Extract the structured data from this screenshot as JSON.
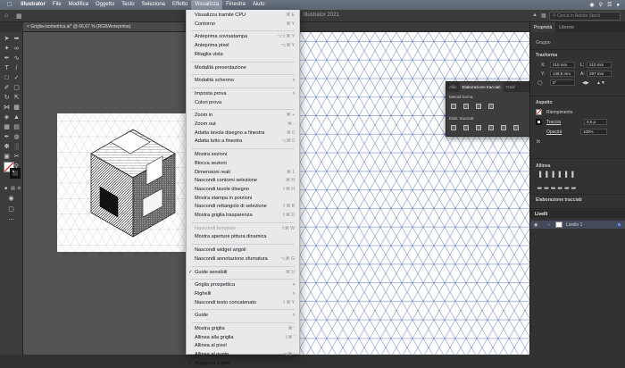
{
  "menubar": {
    "app": "Illustrator",
    "items": [
      "File",
      "Modifica",
      "Oggetto",
      "Testo",
      "Seleziona",
      "Effetto",
      "Visualizza",
      "Finestra",
      "Aiuto"
    ],
    "active": "Visualizza"
  },
  "appbar": {
    "title": "Illustrator 2021",
    "search_placeholder": "Cerca in Adobe Stock"
  },
  "document": {
    "tab_title": "Griglia-isometrica.ai* @ 66,67 % (RGB/Anteprima)"
  },
  "floating_panel": {
    "tabs": [
      "Allin",
      "Elaborazione tracciati",
      "Trasf"
    ],
    "active_tab": "Elaborazione tracciati",
    "shape_modes_label": "Metodi forma:",
    "pathfinders_label": "Elab. tracciati:"
  },
  "properties_panel": {
    "tabs": [
      "Proprietà",
      "Librerie"
    ],
    "selection_label": "Gruppo",
    "transform_title": "Trasforma",
    "x_label": "X:",
    "x_value": "210 mm",
    "y_label": "Y:",
    "y_value": "148,5 mm",
    "w_label": "L:",
    "w_value": "210 mm",
    "h_label": "A:",
    "h_value": "297 mm",
    "rotation_value": "0°",
    "appearance_title": "Aspetto",
    "fill_label": "Riempimento",
    "stroke_label": "Traccia",
    "stroke_value": "0,5 p",
    "opacity_label": "Opacità",
    "opacity_value": "100%",
    "fx_label": "fx",
    "align_title": "Allinea",
    "pathfinder_title": "Elaborazione tracciati",
    "layers_title": "Livelli",
    "layer_name": "Livello 1"
  },
  "view_menu": {
    "items": [
      {
        "label": "Visualizza tramite CPU",
        "shortcut": "⌘ E"
      },
      {
        "label": "Contorno",
        "shortcut": "⌘ Y"
      },
      {
        "sep": true
      },
      {
        "label": "Anteprima sovrastampa",
        "shortcut": "⌥⇧⌘ Y"
      },
      {
        "label": "Anteprima pixel",
        "shortcut": "⌥⌘ Y"
      },
      {
        "label": "Ritaglia vista"
      },
      {
        "sep": true
      },
      {
        "label": "Modalità presentazione"
      },
      {
        "sep": true
      },
      {
        "label": "Modalità schermo",
        "submenu": true
      },
      {
        "sep": true
      },
      {
        "label": "Imposta prova",
        "submenu": true
      },
      {
        "label": "Colori prova"
      },
      {
        "sep": true
      },
      {
        "label": "Zoom in",
        "shortcut": "⌘ +"
      },
      {
        "label": "Zoom out",
        "shortcut": "⌘ -"
      },
      {
        "label": "Adatta tavola disegno a finestra",
        "shortcut": "⌘ 0"
      },
      {
        "label": "Adatta tutto a finestra",
        "shortcut": "⌥⌘ 0"
      },
      {
        "sep": true
      },
      {
        "label": "Mostra sezioni"
      },
      {
        "label": "Blocca sezioni"
      },
      {
        "label": "Dimensioni reali",
        "shortcut": "⌘ 1"
      },
      {
        "label": "Nascondi contorni selezione",
        "shortcut": "⌘ H"
      },
      {
        "label": "Nascondi tavole disegno",
        "shortcut": "⇧⌘ H"
      },
      {
        "label": "Mostra stampa in porzioni"
      },
      {
        "label": "Nascondi rettangolo di selezione",
        "shortcut": "⇧⌘ B"
      },
      {
        "label": "Mostra griglia trasparenza",
        "shortcut": "⇧⌘ D"
      },
      {
        "sep": true
      },
      {
        "label": "Nascondi template",
        "shortcut": "⇧⌘ W",
        "disabled": true
      },
      {
        "label": "Mostra aperture pittura dinamica"
      },
      {
        "sep": true
      },
      {
        "label": "Nascondi widget angoli"
      },
      {
        "label": "Nascondi annotazione sfumatura",
        "shortcut": "⌥⌘ G"
      },
      {
        "sep": true
      },
      {
        "label": "Guide sensibili",
        "shortcut": "⌘ U",
        "checked": true
      },
      {
        "sep": true
      },
      {
        "label": "Griglia prospettica",
        "submenu": true
      },
      {
        "label": "Righelli",
        "submenu": true
      },
      {
        "label": "Nascondi testo concatenato",
        "shortcut": "⇧⌘ Y"
      },
      {
        "sep": true
      },
      {
        "label": "Guide",
        "submenu": true
      },
      {
        "sep": true
      },
      {
        "label": "Mostra griglia",
        "shortcut": "⌘ '"
      },
      {
        "label": "Allinea alla griglia",
        "shortcut": "⇧⌘ '"
      },
      {
        "label": "Allinea al pixel"
      },
      {
        "label": "Allinea al punto",
        "shortcut": "⌥⌘ '"
      },
      {
        "label": "Aggancia a glifo",
        "checked": true
      }
    ]
  },
  "colors": {
    "menubar": "#646d7a",
    "menu_bg": "#e9e9ec",
    "grid_line": "#3e5fb0",
    "panel_bg": "#323232"
  }
}
